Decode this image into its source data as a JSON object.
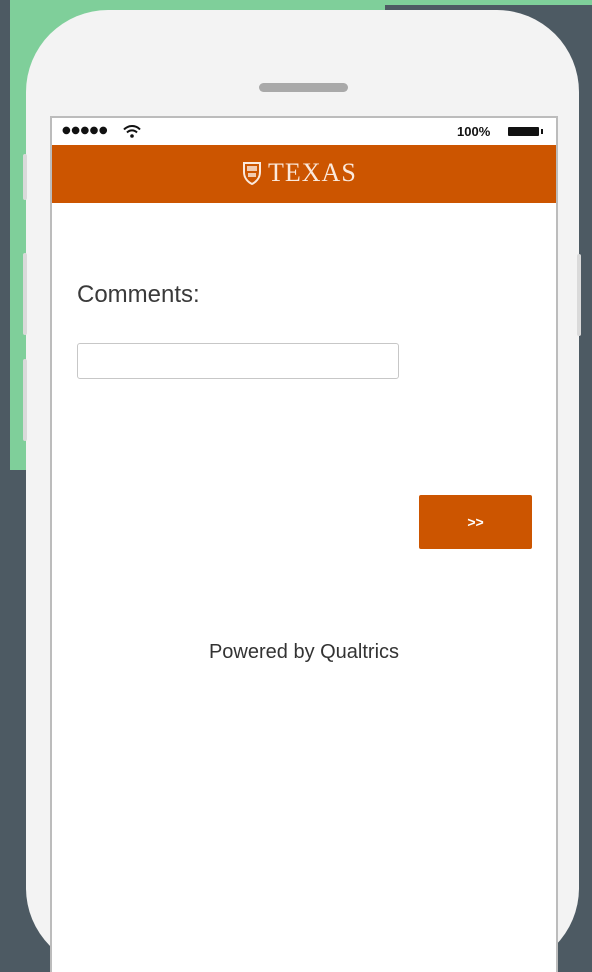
{
  "status_bar": {
    "signal": "●●●●●",
    "battery_percent": "100%",
    "wifi_icon": "wifi-icon",
    "battery_icon": "battery-icon"
  },
  "header": {
    "logo_text": "TEXAS",
    "logo_icon": "shield-icon",
    "brand_color": "#cc5500"
  },
  "question": {
    "label": "Comments:",
    "input_value": "",
    "input_placeholder": ""
  },
  "navigation": {
    "next_label": ">>"
  },
  "footer": {
    "powered_by": "Powered by Qualtrics"
  }
}
